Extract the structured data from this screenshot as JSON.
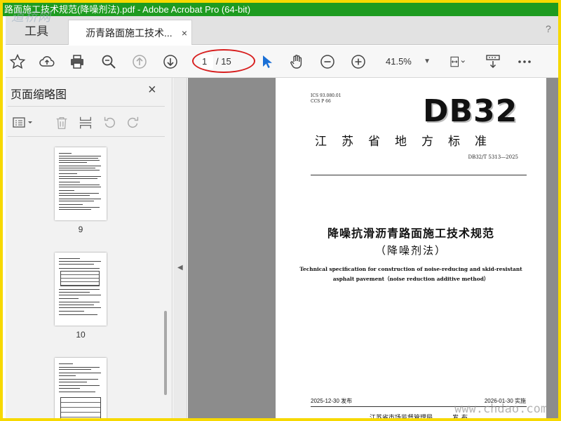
{
  "window": {
    "title": "路面施工技术规范(降噪剂法).pdf - Adobe Acrobat Pro (64-bit)"
  },
  "watermarks": {
    "top_left": "道桥网",
    "bottom_right": "www.chdao.com"
  },
  "tabs": {
    "tools_label": "工具",
    "doc_label": "沥青路面施工技术...",
    "close_glyph": "×",
    "help_glyph": "?"
  },
  "toolbar": {
    "page_current": "1",
    "page_total": "/ 15",
    "zoom": "41.5%",
    "icons": [
      "star-icon",
      "upload-cloud-icon",
      "print-icon",
      "zoom-search-icon",
      "page-up-icon",
      "page-down-icon",
      "select-cursor-icon",
      "hand-icon",
      "zoom-out-icon",
      "zoom-in-icon",
      "page-fit-icon",
      "page-action-icon",
      "more-icon"
    ]
  },
  "left_panel": {
    "title": "页面缩略图",
    "close_glyph": "×",
    "thumbnails": [
      {
        "number": "9"
      },
      {
        "number": "10"
      },
      {
        "number": ""
      }
    ]
  },
  "document": {
    "ics": "ICS 93.080.01",
    "ccs": "CCS P 66",
    "db_code": "DB32",
    "std_type": "江苏省地方标准",
    "std_number": "DB32/T 5313—2025",
    "title": "降噪抗滑沥青路面施工技术规范",
    "subtitle": "（降噪剂法）",
    "english_line1": "Technical specification for construction of noise-reducing and skid-resistant",
    "english_line2": "asphalt pavement（noise reduction additive method）",
    "issue_date": "2025-12-30 发布",
    "impl_date": "2026-01-30 实施",
    "publisher": "江苏省市场监督管理局",
    "publish_label": "发布"
  },
  "colors": {
    "title_bar": "#1e9b20",
    "frame": "#f7d900",
    "annotation": "#d81f1f",
    "cursor_blue": "#1a6fd6"
  }
}
